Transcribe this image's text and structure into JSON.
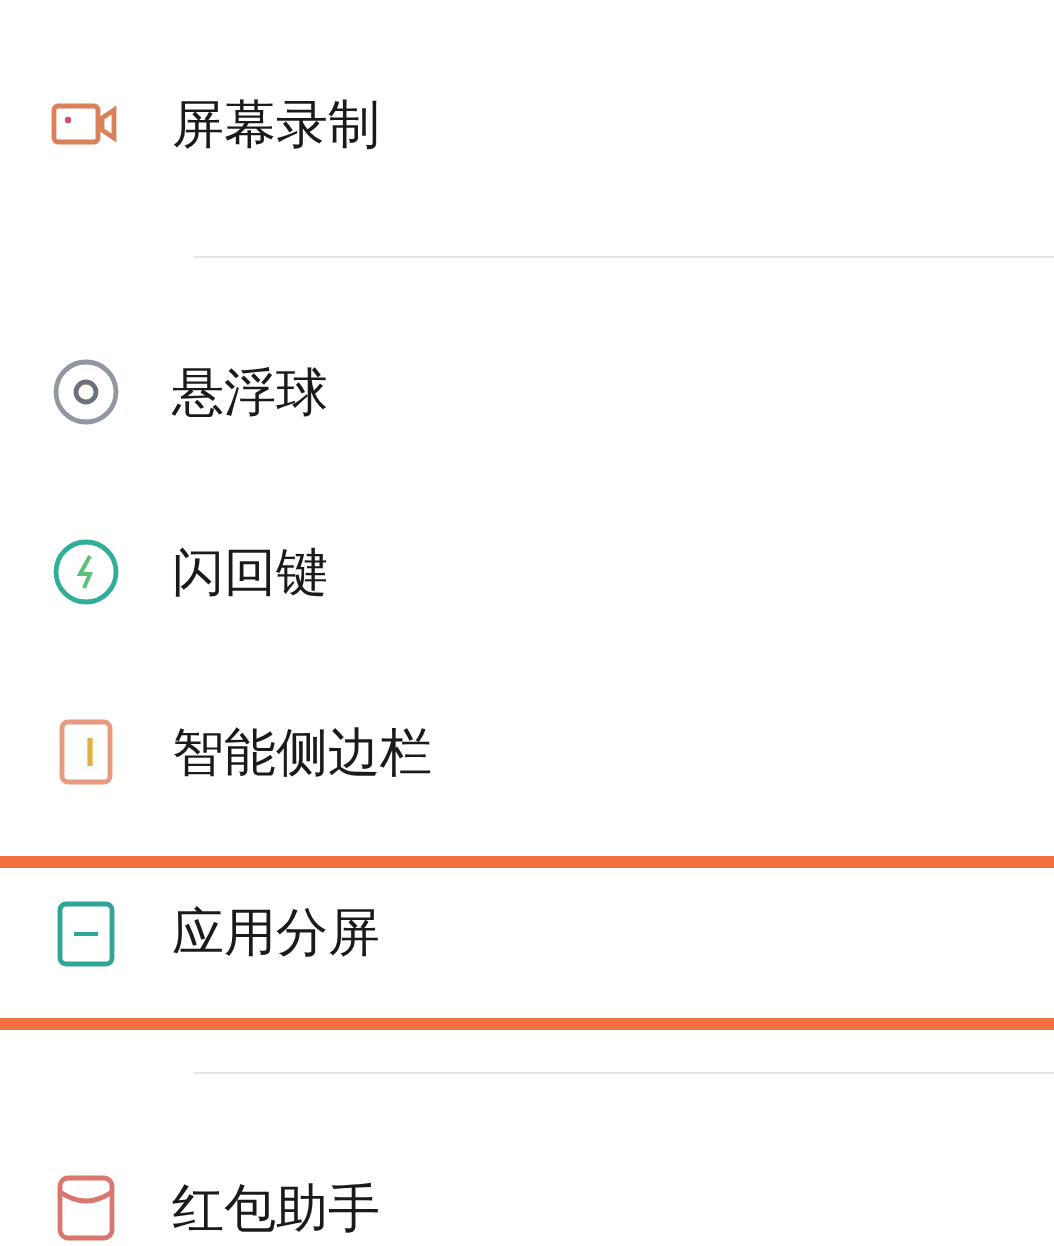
{
  "groups": [
    {
      "items": [
        {
          "label": "屏幕录制",
          "highlighted": false
        }
      ]
    },
    {
      "items": [
        {
          "label": "悬浮球",
          "highlighted": false
        },
        {
          "label": "闪回键",
          "highlighted": false
        },
        {
          "label": "智能侧边栏",
          "highlighted": false
        },
        {
          "label": "应用分屏",
          "highlighted": true
        }
      ]
    },
    {
      "items": [
        {
          "label": "红包助手",
          "highlighted": false
        }
      ]
    }
  ]
}
